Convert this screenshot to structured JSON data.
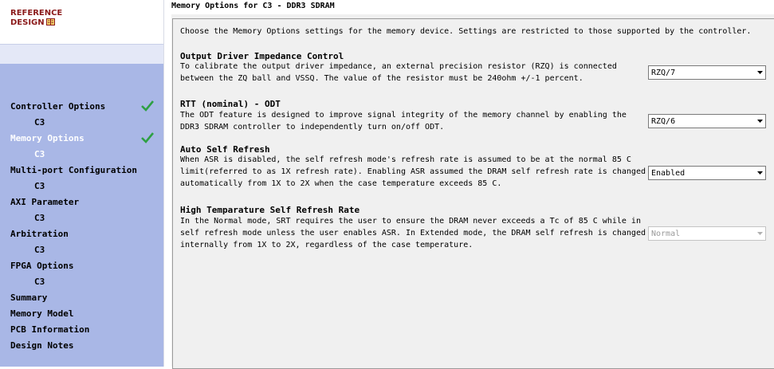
{
  "logo": {
    "line1": "REFERENCE",
    "line2": "DESIGN"
  },
  "nav": [
    {
      "label": "Controller Options",
      "sub": false,
      "active": false,
      "check": true
    },
    {
      "label": "C3",
      "sub": true,
      "active": false,
      "check": false
    },
    {
      "label": "Memory Options",
      "sub": false,
      "active": true,
      "check": true
    },
    {
      "label": "C3",
      "sub": true,
      "active": true,
      "check": false
    },
    {
      "label": "Multi-port Configuration",
      "sub": false,
      "active": false,
      "check": false
    },
    {
      "label": "C3",
      "sub": true,
      "active": false,
      "check": false
    },
    {
      "label": "AXI Parameter",
      "sub": false,
      "active": false,
      "check": false
    },
    {
      "label": "C3",
      "sub": true,
      "active": false,
      "check": false
    },
    {
      "label": "Arbitration",
      "sub": false,
      "active": false,
      "check": false
    },
    {
      "label": "C3",
      "sub": true,
      "active": false,
      "check": false
    },
    {
      "label": "FPGA Options",
      "sub": false,
      "active": false,
      "check": false
    },
    {
      "label": "C3",
      "sub": true,
      "active": false,
      "check": false
    },
    {
      "label": "Summary",
      "sub": false,
      "active": false,
      "check": false
    },
    {
      "label": "Memory Model",
      "sub": false,
      "active": false,
      "check": false
    },
    {
      "label": "PCB Information",
      "sub": false,
      "active": false,
      "check": false
    },
    {
      "label": "Design Notes",
      "sub": false,
      "active": false,
      "check": false
    }
  ],
  "page": {
    "title": "Memory Options for C3 - DDR3 SDRAM",
    "intro": "Choose the Memory Options settings for the memory device. Settings are restricted to those supported by the controller."
  },
  "settings": {
    "odi": {
      "title": "Output Driver Impedance Control",
      "desc1": "To calibrate the output driver impedance, an external precision resistor (RZQ) is connected",
      "desc2": "between the ZQ ball and VSSQ. The value of the resistor must be 240ohm +/-1 percent.",
      "value": "RZQ/7"
    },
    "rtt": {
      "title": "RTT (nominal) - ODT",
      "desc1": "The ODT feature is designed to improve signal integrity of the memory channel by enabling the",
      "desc2": "DDR3 SDRAM controller to independently turn on/off ODT.",
      "value": "RZQ/6"
    },
    "asr": {
      "title": "Auto Self Refresh",
      "desc1": "When ASR is disabled, the self refresh mode's refresh rate is assumed to be at the normal 85 C",
      "desc2": "limit(referred to as 1X refresh rate). Enabling ASR assumed the DRAM self refresh rate is changed",
      "desc3": "automatically from 1X to 2X when the case temperature exceeds 85 C.",
      "value": "Enabled"
    },
    "srt": {
      "title": "High Temparature Self Refresh Rate",
      "desc1": "In the Normal mode, SRT requires the user to ensure the DRAM never exceeds a Tc of 85 C while in",
      "desc2": "self refresh mode unless the user enables ASR. In Extended mode, the DRAM self refresh is changed",
      "desc3": "internally from 1X to 2X, regardless of the case temperature.",
      "value": "Normal"
    }
  },
  "colors": {
    "sidebar": "#a9b7e6",
    "check": "#2ea043",
    "logo": "#8b1a1a"
  }
}
